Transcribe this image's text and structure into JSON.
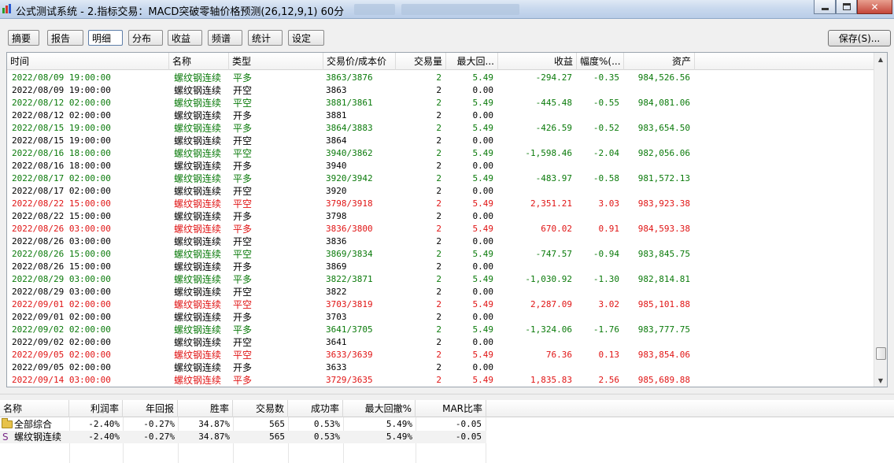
{
  "window": {
    "title": "公式测试系统 - 2.指标交易：MACD突破零轴价格预测(26,12,9,1) 60分"
  },
  "tabs": [
    "摘要",
    "报告",
    "明细",
    "分布",
    "收益",
    "频谱",
    "统计",
    "设定"
  ],
  "active_tab": "明细",
  "save_button": "保存(S)...",
  "detail": {
    "columns": [
      "时间",
      "名称",
      "类型",
      "交易价/成本价",
      "交易量",
      "最大回...",
      "收益",
      "幅度%(...",
      "资产"
    ],
    "rows": [
      {
        "time": "2022/08/09 19:00:00",
        "name": "螺纹钢连续",
        "type": "平多",
        "price": "3863/3876",
        "vol": "2",
        "maxdd": "5.49",
        "profit": "-294.27",
        "pct": "-0.35",
        "asset": "984,526.56",
        "color": "green"
      },
      {
        "time": "2022/08/09 19:00:00",
        "name": "螺纹钢连续",
        "type": "开空",
        "price": "3863",
        "vol": "2",
        "maxdd": "0.00",
        "profit": "",
        "pct": "",
        "asset": "",
        "color": "black"
      },
      {
        "time": "2022/08/12 02:00:00",
        "name": "螺纹钢连续",
        "type": "平空",
        "price": "3881/3861",
        "vol": "2",
        "maxdd": "5.49",
        "profit": "-445.48",
        "pct": "-0.55",
        "asset": "984,081.06",
        "color": "green"
      },
      {
        "time": "2022/08/12 02:00:00",
        "name": "螺纹钢连续",
        "type": "开多",
        "price": "3881",
        "vol": "2",
        "maxdd": "0.00",
        "profit": "",
        "pct": "",
        "asset": "",
        "color": "black"
      },
      {
        "time": "2022/08/15 19:00:00",
        "name": "螺纹钢连续",
        "type": "平多",
        "price": "3864/3883",
        "vol": "2",
        "maxdd": "5.49",
        "profit": "-426.59",
        "pct": "-0.52",
        "asset": "983,654.50",
        "color": "green"
      },
      {
        "time": "2022/08/15 19:00:00",
        "name": "螺纹钢连续",
        "type": "开空",
        "price": "3864",
        "vol": "2",
        "maxdd": "0.00",
        "profit": "",
        "pct": "",
        "asset": "",
        "color": "black"
      },
      {
        "time": "2022/08/16 18:00:00",
        "name": "螺纹钢连续",
        "type": "平空",
        "price": "3940/3862",
        "vol": "2",
        "maxdd": "5.49",
        "profit": "-1,598.46",
        "pct": "-2.04",
        "asset": "982,056.06",
        "color": "green"
      },
      {
        "time": "2022/08/16 18:00:00",
        "name": "螺纹钢连续",
        "type": "开多",
        "price": "3940",
        "vol": "2",
        "maxdd": "0.00",
        "profit": "",
        "pct": "",
        "asset": "",
        "color": "black"
      },
      {
        "time": "2022/08/17 02:00:00",
        "name": "螺纹钢连续",
        "type": "平多",
        "price": "3920/3942",
        "vol": "2",
        "maxdd": "5.49",
        "profit": "-483.97",
        "pct": "-0.58",
        "asset": "981,572.13",
        "color": "green"
      },
      {
        "time": "2022/08/17 02:00:00",
        "name": "螺纹钢连续",
        "type": "开空",
        "price": "3920",
        "vol": "2",
        "maxdd": "0.00",
        "profit": "",
        "pct": "",
        "asset": "",
        "color": "black"
      },
      {
        "time": "2022/08/22 15:00:00",
        "name": "螺纹钢连续",
        "type": "平空",
        "price": "3798/3918",
        "vol": "2",
        "maxdd": "5.49",
        "profit": "2,351.21",
        "pct": "3.03",
        "asset": "983,923.38",
        "color": "red"
      },
      {
        "time": "2022/08/22 15:00:00",
        "name": "螺纹钢连续",
        "type": "开多",
        "price": "3798",
        "vol": "2",
        "maxdd": "0.00",
        "profit": "",
        "pct": "",
        "asset": "",
        "color": "black"
      },
      {
        "time": "2022/08/26 03:00:00",
        "name": "螺纹钢连续",
        "type": "平多",
        "price": "3836/3800",
        "vol": "2",
        "maxdd": "5.49",
        "profit": "670.02",
        "pct": "0.91",
        "asset": "984,593.38",
        "color": "red"
      },
      {
        "time": "2022/08/26 03:00:00",
        "name": "螺纹钢连续",
        "type": "开空",
        "price": "3836",
        "vol": "2",
        "maxdd": "0.00",
        "profit": "",
        "pct": "",
        "asset": "",
        "color": "black"
      },
      {
        "time": "2022/08/26 15:00:00",
        "name": "螺纹钢连续",
        "type": "平空",
        "price": "3869/3834",
        "vol": "2",
        "maxdd": "5.49",
        "profit": "-747.57",
        "pct": "-0.94",
        "asset": "983,845.75",
        "color": "green"
      },
      {
        "time": "2022/08/26 15:00:00",
        "name": "螺纹钢连续",
        "type": "开多",
        "price": "3869",
        "vol": "2",
        "maxdd": "0.00",
        "profit": "",
        "pct": "",
        "asset": "",
        "color": "black"
      },
      {
        "time": "2022/08/29 03:00:00",
        "name": "螺纹钢连续",
        "type": "平多",
        "price": "3822/3871",
        "vol": "2",
        "maxdd": "5.49",
        "profit": "-1,030.92",
        "pct": "-1.30",
        "asset": "982,814.81",
        "color": "green"
      },
      {
        "time": "2022/08/29 03:00:00",
        "name": "螺纹钢连续",
        "type": "开空",
        "price": "3822",
        "vol": "2",
        "maxdd": "0.00",
        "profit": "",
        "pct": "",
        "asset": "",
        "color": "black"
      },
      {
        "time": "2022/09/01 02:00:00",
        "name": "螺纹钢连续",
        "type": "平空",
        "price": "3703/3819",
        "vol": "2",
        "maxdd": "5.49",
        "profit": "2,287.09",
        "pct": "3.02",
        "asset": "985,101.88",
        "color": "red"
      },
      {
        "time": "2022/09/01 02:00:00",
        "name": "螺纹钢连续",
        "type": "开多",
        "price": "3703",
        "vol": "2",
        "maxdd": "0.00",
        "profit": "",
        "pct": "",
        "asset": "",
        "color": "black"
      },
      {
        "time": "2022/09/02 02:00:00",
        "name": "螺纹钢连续",
        "type": "平多",
        "price": "3641/3705",
        "vol": "2",
        "maxdd": "5.49",
        "profit": "-1,324.06",
        "pct": "-1.76",
        "asset": "983,777.75",
        "color": "green"
      },
      {
        "time": "2022/09/02 02:00:00",
        "name": "螺纹钢连续",
        "type": "开空",
        "price": "3641",
        "vol": "2",
        "maxdd": "0.00",
        "profit": "",
        "pct": "",
        "asset": "",
        "color": "black"
      },
      {
        "time": "2022/09/05 02:00:00",
        "name": "螺纹钢连续",
        "type": "平空",
        "price": "3633/3639",
        "vol": "2",
        "maxdd": "5.49",
        "profit": "76.36",
        "pct": "0.13",
        "asset": "983,854.06",
        "color": "red"
      },
      {
        "time": "2022/09/05 02:00:00",
        "name": "螺纹钢连续",
        "type": "开多",
        "price": "3633",
        "vol": "2",
        "maxdd": "0.00",
        "profit": "",
        "pct": "",
        "asset": "",
        "color": "black"
      },
      {
        "time": "2022/09/14 03:00:00",
        "name": "螺纹钢连续",
        "type": "平多",
        "price": "3729/3635",
        "vol": "2",
        "maxdd": "5.49",
        "profit": "1,835.83",
        "pct": "2.56",
        "asset": "985,689.88",
        "color": "red"
      }
    ]
  },
  "summary": {
    "columns": [
      "名称",
      "利润率",
      "年回报",
      "胜率",
      "交易数",
      "成功率",
      "最大回撤%",
      "MAR比率"
    ],
    "rows": [
      {
        "icon": "folder-icon",
        "name": "全部综合",
        "profit_rate": "-2.40%",
        "annual": "-0.27%",
        "win_rate": "34.87%",
        "trades": "565",
        "success": "0.53%",
        "max_dd": "5.49%",
        "mar": "-0.05"
      },
      {
        "icon": "s-icon",
        "icon_glyph": "S",
        "name": "螺纹钢连续",
        "profit_rate": "-2.40%",
        "annual": "-0.27%",
        "win_rate": "34.87%",
        "trades": "565",
        "success": "0.53%",
        "max_dd": "5.49%",
        "mar": "-0.05"
      }
    ]
  },
  "colors": {
    "profit_up": "#e01414",
    "profit_down": "#0a7a0a",
    "neutral": "#000000"
  }
}
